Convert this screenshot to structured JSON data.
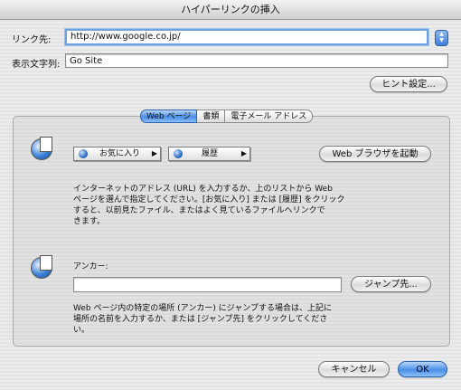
{
  "window": {
    "title": "ハイパーリンクの挿入"
  },
  "link": {
    "label": "リンク先:",
    "value": "http://www.google.co.jp/"
  },
  "display_text": {
    "label": "表示文字列:",
    "value": "Go Site"
  },
  "buttons": {
    "hint": "ヒント設定...",
    "web_browser": "Web ブラウザを起動",
    "jump": "ジャンプ先...",
    "cancel": "キャンセル",
    "ok": "OK"
  },
  "tabs": [
    {
      "label": "Web ページ",
      "active": true
    },
    {
      "label": "書類",
      "active": false
    },
    {
      "label": "電子メール アドレス",
      "active": false
    }
  ],
  "popups": {
    "favorites": "お気に入り",
    "history": "履歴"
  },
  "web_help": [
    "インターネットのアドレス (URL) を入力するか、上のリストから Web",
    "ページを選んで指定してください。[お気に入り] または [履歴] をクリック",
    "すると、以前見たファイル、またはよく見ているファイルへリンクで",
    "きます。"
  ],
  "anchor": {
    "label": "アンカー:",
    "value": ""
  },
  "anchor_help": [
    "Web ページ内の特定の場所 (アンカー) にジャンプする場合は、上記に",
    "場所の名前を入力するか、または [ジャンプ先] をクリックしてくださ",
    "い。"
  ],
  "colors": {
    "accent": "#4a8ee6",
    "focus": "#6fa0e0"
  }
}
